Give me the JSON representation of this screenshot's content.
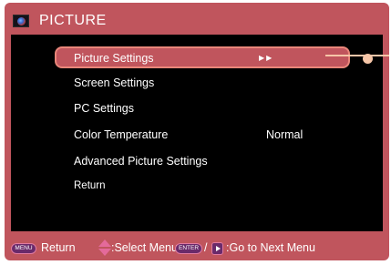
{
  "header": {
    "title": "PICTURE"
  },
  "menu": {
    "items": [
      {
        "label": "Picture Settings",
        "value": "",
        "selected": true
      },
      {
        "label": "Screen Settings",
        "value": ""
      },
      {
        "label": "PC Settings",
        "value": ""
      },
      {
        "label": "Color Temperature",
        "value": "Normal"
      },
      {
        "label": "Advanced Picture Settings",
        "value": ""
      },
      {
        "label": "Return",
        "value": ""
      }
    ],
    "selected_indicator": "▶▶"
  },
  "footer": {
    "menu_key": "MENU",
    "return_label": "Return",
    "select_label": ":Select Menu",
    "enter_key": "ENTER",
    "slash": "/",
    "next_label": ":Go to Next Menu"
  },
  "colors": {
    "frame": "#c0555d",
    "screen": "#000000",
    "highlight_border": "#e9867a"
  }
}
